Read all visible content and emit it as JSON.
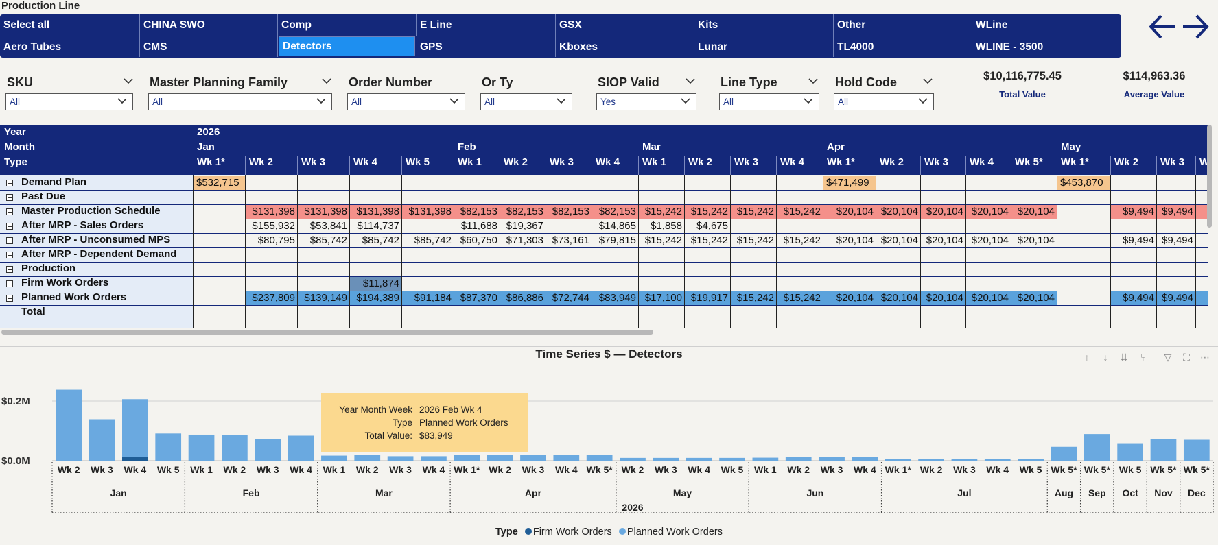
{
  "production_line": {
    "title": "Production Line",
    "selected": "Detectors",
    "items": [
      "Select all",
      "CHINA SWO",
      "Comp",
      "E Line",
      "GSX",
      "Kits",
      "Other",
      "WLine",
      "Aero Tubes",
      "CMS",
      "Detectors",
      "GPS",
      "Kboxes",
      "Lunar",
      "TL4000",
      "WLINE - 3500"
    ]
  },
  "nav": {
    "back_icon": "arrow-left-icon",
    "forward_icon": "arrow-right-icon"
  },
  "filters": [
    {
      "label": "SKU",
      "value": "All"
    },
    {
      "label": "Master Planning Family",
      "value": "All"
    },
    {
      "label": "Order Number",
      "value": "All"
    },
    {
      "label": "Or Ty",
      "value": "All"
    },
    {
      "label": "SIOP Valid",
      "value": "Yes"
    },
    {
      "label": "Line Type",
      "value": "All"
    },
    {
      "label": "Hold Code",
      "value": "All"
    }
  ],
  "kpis": [
    {
      "value": "$10,116,775.45",
      "label": "Total Value"
    },
    {
      "value": "$114,963.36",
      "label": "Average Value"
    }
  ],
  "matrix": {
    "header_labels": {
      "year": "Year",
      "month": "Month",
      "type": "Type"
    },
    "year": "2026",
    "months": [
      {
        "name": "Jan",
        "span": 5
      },
      {
        "name": "Feb",
        "span": 4
      },
      {
        "name": "Mar",
        "span": 4
      },
      {
        "name": "Apr",
        "span": 5
      },
      {
        "name": "May",
        "span": 4
      }
    ],
    "weeks": [
      "Wk 1*",
      "Wk 2",
      "Wk 3",
      "Wk 4",
      "Wk 5",
      "Wk 1",
      "Wk 2",
      "Wk 3",
      "Wk 4",
      "Wk 1",
      "Wk 2",
      "Wk 3",
      "Wk 4",
      "Wk 1*",
      "Wk 2",
      "Wk 3",
      "Wk 4",
      "Wk 5*",
      "Wk 1*",
      "Wk 2",
      "Wk 3",
      "W"
    ],
    "rows": [
      {
        "label": "Demand Plan",
        "style": "demand",
        "cells": [
          "$532,715",
          "",
          "",
          "",
          "",
          "",
          "",
          "",
          "",
          "",
          "",
          "",
          "",
          "$471,499",
          "",
          "",
          "",
          "",
          "$453,870",
          "",
          "",
          ""
        ]
      },
      {
        "label": "Past Due",
        "style": "plain",
        "cells": [
          "",
          "",
          "",
          "",
          "",
          "",
          "",
          "",
          "",
          "",
          "",
          "",
          "",
          "",
          "",
          "",
          "",
          "",
          "",
          "",
          "",
          ""
        ]
      },
      {
        "label": "Master Production Schedule",
        "style": "mps",
        "cells": [
          "",
          "$131,398",
          "$131,398",
          "$131,398",
          "$131,398",
          "$82,153",
          "$82,153",
          "$82,153",
          "$82,153",
          "$15,242",
          "$15,242",
          "$15,242",
          "$15,242",
          "$20,104",
          "$20,104",
          "$20,104",
          "$20,104",
          "$20,104",
          "",
          "$9,494",
          "$9,494",
          "$9"
        ]
      },
      {
        "label": "After MRP - Sales Orders",
        "style": "plain",
        "cells": [
          "",
          "$155,932",
          "$53,841",
          "$114,737",
          "",
          "$11,688",
          "$19,367",
          "",
          "$14,865",
          "$1,858",
          "$4,675",
          "",
          "",
          "",
          "",
          "",
          "",
          "",
          "",
          "",
          "",
          ""
        ]
      },
      {
        "label": "After MRP - Unconsumed MPS",
        "style": "plain",
        "cells": [
          "",
          "$80,795",
          "$85,742",
          "$85,742",
          "$85,742",
          "$60,750",
          "$71,303",
          "$73,161",
          "$79,815",
          "$15,242",
          "$15,242",
          "$15,242",
          "$15,242",
          "$20,104",
          "$20,104",
          "$20,104",
          "$20,104",
          "$20,104",
          "",
          "$9,494",
          "$9,494",
          "$9"
        ]
      },
      {
        "label": "After MRP - Dependent Demand",
        "style": "plain",
        "cells": [
          "",
          "",
          "",
          "",
          "",
          "",
          "",
          "",
          "",
          "",
          "",
          "",
          "",
          "",
          "",
          "",
          "",
          "",
          "",
          "",
          "",
          ""
        ]
      },
      {
        "label": "Production",
        "style": "plain",
        "cells": [
          "",
          "",
          "",
          "",
          "",
          "",
          "",
          "",
          "",
          "",
          "",
          "",
          "",
          "",
          "",
          "",
          "",
          "",
          "",
          "",
          "",
          ""
        ]
      },
      {
        "label": "Firm Work Orders",
        "style": "firm",
        "cells": [
          "",
          "",
          "",
          "$11,874",
          "",
          "",
          "",
          "",
          "",
          "",
          "",
          "",
          "",
          "",
          "",
          "",
          "",
          "",
          "",
          "",
          "",
          ""
        ]
      },
      {
        "label": "Planned Work Orders",
        "style": "pwo",
        "cells": [
          "",
          "$237,809",
          "$139,149",
          "$194,389",
          "$91,184",
          "$87,370",
          "$86,886",
          "$72,744",
          "$83,949",
          "$17,100",
          "$19,917",
          "$15,242",
          "$15,242",
          "$20,104",
          "$20,104",
          "$20,104",
          "$20,104",
          "$20,104",
          "",
          "$9,494",
          "$9,494",
          "$9"
        ]
      },
      {
        "label": "Total",
        "style": "total",
        "cells": []
      }
    ]
  },
  "chart": {
    "title": "Time Series $ — Detectors",
    "toolbar_icons": [
      "drill-up-icon",
      "drill-down-icon",
      "expand-next-level-icon",
      "drill-through-icon",
      "filter-icon",
      "focus-mode-icon",
      "more-options-icon"
    ]
  },
  "chart_data": {
    "type": "bar",
    "stacked": true,
    "ylabel_ticks": [
      "$0.0M",
      "$0.2M"
    ],
    "ylim": [
      0,
      0.3
    ],
    "y_ticks": [
      0,
      0.2
    ],
    "unit": "$M",
    "grid": true,
    "x_levels": {
      "year": "2026",
      "months": [
        {
          "name": "Jan",
          "count": 4
        },
        {
          "name": "Feb",
          "count": 4
        },
        {
          "name": "Mar",
          "count": 4
        },
        {
          "name": "Apr",
          "count": 5
        },
        {
          "name": "May",
          "count": 4
        },
        {
          "name": "Jun",
          "count": 4
        },
        {
          "name": "Jul",
          "count": 5
        },
        {
          "name": "Aug",
          "count": 1
        },
        {
          "name": "Sep",
          "count": 1
        },
        {
          "name": "Oct",
          "count": 1
        },
        {
          "name": "Nov",
          "count": 1
        },
        {
          "name": "Dec",
          "count": 1
        }
      ]
    },
    "categories": [
      "Wk 2",
      "Wk 3",
      "Wk 4",
      "Wk 5",
      "Wk 1",
      "Wk 2",
      "Wk 3",
      "Wk 4",
      "Wk 1",
      "Wk 2",
      "Wk 3",
      "Wk 4",
      "Wk 1*",
      "Wk 2",
      "Wk 3",
      "Wk 4",
      "Wk 5*",
      "Wk 2",
      "Wk 3",
      "Wk 4",
      "Wk 5",
      "Wk 1",
      "Wk 2",
      "Wk 3",
      "Wk 4",
      "Wk 1*",
      "Wk 2",
      "Wk 3",
      "Wk 4",
      "Wk 5",
      "Wk 5*",
      "Wk 5*",
      "Wk 5",
      "Wk 5*",
      "Wk 5*"
    ],
    "series": [
      {
        "name": "Firm Work Orders",
        "color": "#1f5d96",
        "values": [
          0,
          0,
          0.0119,
          0,
          0,
          0,
          0,
          0,
          0,
          0,
          0,
          0,
          0,
          0,
          0,
          0,
          0,
          0,
          0,
          0,
          0,
          0,
          0,
          0,
          0,
          0,
          0,
          0,
          0,
          0,
          0,
          0,
          0,
          0,
          0
        ]
      },
      {
        "name": "Planned Work Orders",
        "color": "#6aa9e0",
        "values": [
          0.2378,
          0.1391,
          0.1944,
          0.0912,
          0.0874,
          0.0869,
          0.0727,
          0.0839,
          0.0171,
          0.0199,
          0.0152,
          0.0152,
          0.0201,
          0.0201,
          0.0201,
          0.0201,
          0.0201,
          0.0095,
          0.0095,
          0.0095,
          0.0095,
          0.0102,
          0.0118,
          0.0118,
          0.0118,
          0.0065,
          0.0065,
          0.0065,
          0.0065,
          0.0065,
          0.0465,
          0.0894,
          0.0585,
          0.0719,
          0.0701
        ]
      }
    ],
    "legend": {
      "title": "Type",
      "position": "bottom-center"
    }
  },
  "tooltip": {
    "rows": [
      {
        "key": "Year Month Week",
        "value": "2026 Feb Wk 4"
      },
      {
        "key": "Type",
        "value": "Planned Work Orders"
      },
      {
        "key": "Total Value:",
        "value": "$83,949"
      }
    ]
  },
  "colors": {
    "header_navy": "#14287a",
    "selected_blue": "#1e8ff0",
    "demand": "#f5c58e",
    "mps": "#f4908a",
    "firm": "#6a90b8",
    "pwo": "#5aa2dc",
    "tooltip": "#fbd98f"
  }
}
